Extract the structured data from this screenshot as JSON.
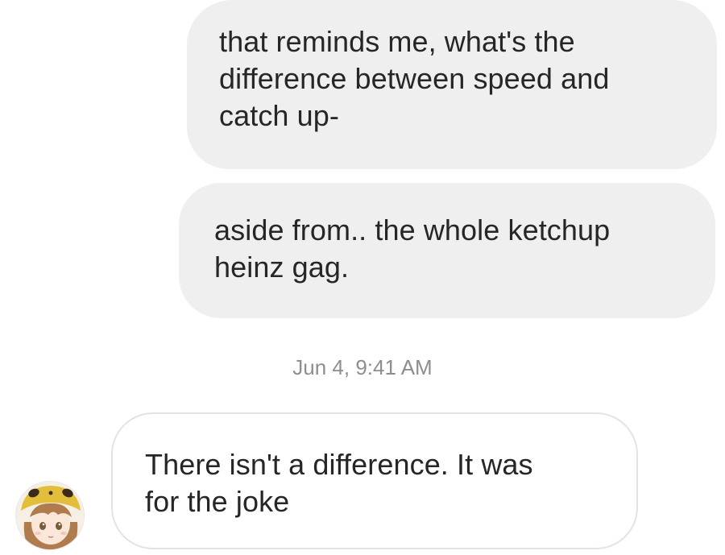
{
  "messages": [
    {
      "direction": "sent",
      "lines": [
        "that reminds me, what's the",
        "difference between speed and",
        "catch up-"
      ]
    },
    {
      "direction": "sent",
      "lines": [
        "aside from.. the whole ketchup",
        "heinz gag."
      ]
    },
    {
      "direction": "received",
      "lines": [
        "There isn't a difference. It was",
        "for the joke"
      ]
    }
  ],
  "timestamp": "Jun 4, 9:41 AM",
  "avatar": {
    "icon": "anime-avatar-icon",
    "colors": {
      "hat": "#e3bd3c",
      "hair": "#b07c4e",
      "skin": "#fbe7da"
    }
  },
  "colors": {
    "sent_bubble": "#efefef",
    "received_border": "#e3e3e3",
    "text": "#262626",
    "timestamp": "#8e8e8e"
  }
}
